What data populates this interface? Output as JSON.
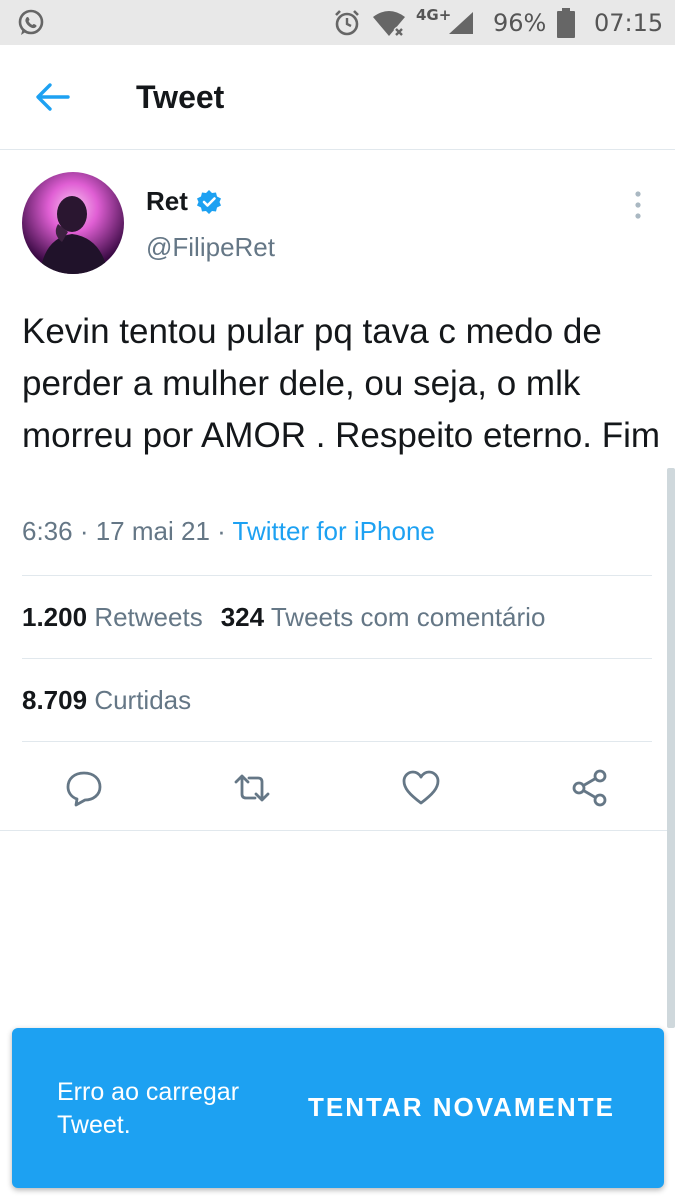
{
  "status_bar": {
    "network": "4G+",
    "battery": "96%",
    "time": "07:15",
    "icons": [
      "whatsapp-icon",
      "alarm-icon",
      "wifi-off-icon",
      "signal-icon",
      "battery-icon"
    ]
  },
  "header": {
    "title": "Tweet",
    "back_icon": "arrow-left-icon"
  },
  "tweet": {
    "author": {
      "name": "Ret",
      "handle": "@FilipeRet",
      "verified": true
    },
    "text": "Kevin tentou pular pq tava c medo de perder a mulher dele, ou seja, o mlk morreu por AMOR . Respeito eterno. Fim",
    "time": "6:36",
    "date": "17 mai 21",
    "separator": " · ",
    "source": "Twitter for iPhone",
    "stats": {
      "retweets_count": "1.200",
      "retweets_label": "Retweets",
      "quotes_count": "324",
      "quotes_label": "Tweets com comentário",
      "likes_count": "8.709",
      "likes_label": "Curtidas"
    },
    "actions": [
      "reply-icon",
      "retweet-icon",
      "like-icon",
      "share-icon"
    ]
  },
  "snackbar": {
    "message": "Erro ao carregar Tweet.",
    "action": "TENTAR NOVAMENTE"
  },
  "colors": {
    "accent": "#1da1f2",
    "text_primary": "#14171a",
    "text_secondary": "#657786",
    "divider": "#e1e8ed",
    "status_bar_bg": "#e8e8e8"
  }
}
